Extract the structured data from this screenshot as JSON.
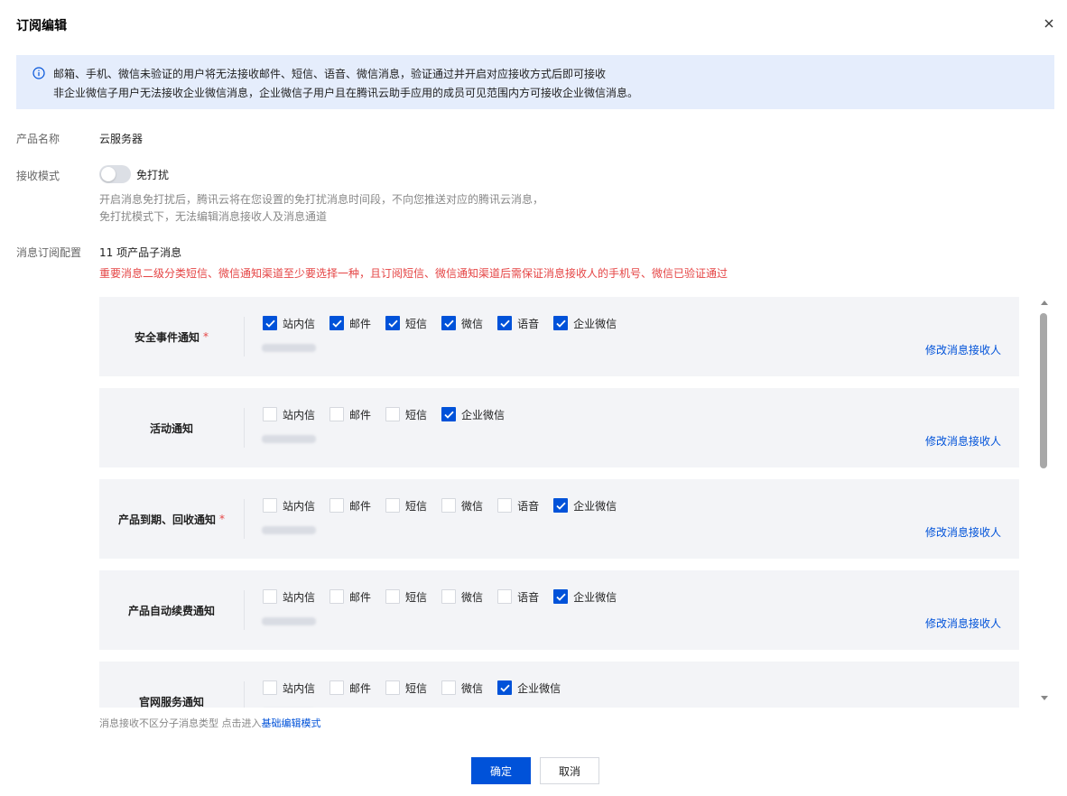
{
  "dialog": {
    "title": "订阅编辑"
  },
  "notice": {
    "line1": "邮箱、手机、微信未验证的用户将无法接收邮件、短信、语音、微信消息，验证通过并开启对应接收方式后即可接收",
    "line2": "非企业微信子用户无法接收企业微信消息，企业微信子用户且在腾讯云助手应用的成员可见范围内方可接收企业微信消息。"
  },
  "form": {
    "product_label": "产品名称",
    "product_value": "云服务器",
    "mode_label": "接收模式",
    "mode_switch_label": "免打扰",
    "mode_desc1": "开启消息免打扰后，腾讯云将在您设置的免打扰消息时间段，不向您推送对应的腾讯云消息，",
    "mode_desc2": "免打扰模式下，无法编辑消息接收人及消息通道",
    "config_label": "消息订阅配置",
    "config_count": "11 项产品子消息",
    "config_warning": "重要消息二级分类短信、微信通知渠道至少要选择一种，且订阅短信、微信通知渠道后需保证消息接收人的手机号、微信已验证通过"
  },
  "cards": [
    {
      "name": "安全事件通知",
      "required": "*",
      "channels": [
        {
          "label": "站内信",
          "checked": true
        },
        {
          "label": "邮件",
          "checked": true
        },
        {
          "label": "短信",
          "checked": true
        },
        {
          "label": "微信",
          "checked": true
        },
        {
          "label": "语音",
          "checked": true
        },
        {
          "label": "企业微信",
          "checked": true
        }
      ],
      "modify": "修改消息接收人"
    },
    {
      "name": "活动通知",
      "required": "",
      "channels": [
        {
          "label": "站内信",
          "checked": false
        },
        {
          "label": "邮件",
          "checked": false
        },
        {
          "label": "短信",
          "checked": false
        },
        {
          "label": "企业微信",
          "checked": true
        }
      ],
      "modify": "修改消息接收人"
    },
    {
      "name": "产品到期、回收通知",
      "required": "*",
      "channels": [
        {
          "label": "站内信",
          "checked": false
        },
        {
          "label": "邮件",
          "checked": false
        },
        {
          "label": "短信",
          "checked": false
        },
        {
          "label": "微信",
          "checked": false
        },
        {
          "label": "语音",
          "checked": false
        },
        {
          "label": "企业微信",
          "checked": true
        }
      ],
      "modify": "修改消息接收人"
    },
    {
      "name": "产品自动续费通知",
      "required": "",
      "channels": [
        {
          "label": "站内信",
          "checked": false
        },
        {
          "label": "邮件",
          "checked": false
        },
        {
          "label": "短信",
          "checked": false
        },
        {
          "label": "微信",
          "checked": false
        },
        {
          "label": "语音",
          "checked": false
        },
        {
          "label": "企业微信",
          "checked": true
        }
      ],
      "modify": "修改消息接收人"
    },
    {
      "name": "官网服务通知",
      "required": "",
      "channels": [
        {
          "label": "站内信",
          "checked": false
        },
        {
          "label": "邮件",
          "checked": false
        },
        {
          "label": "短信",
          "checked": false
        },
        {
          "label": "微信",
          "checked": false
        },
        {
          "label": "企业微信",
          "checked": true
        }
      ],
      "modify": ""
    }
  ],
  "footer": {
    "note": "消息接收不区分子消息类型 点击进入",
    "link": "基础编辑模式",
    "ok": "确定",
    "cancel": "取消"
  },
  "colors": {
    "primary": "#0052d9",
    "danger": "#e54545",
    "notice_bg": "#e5edfc",
    "card_bg": "#f3f4f7"
  }
}
